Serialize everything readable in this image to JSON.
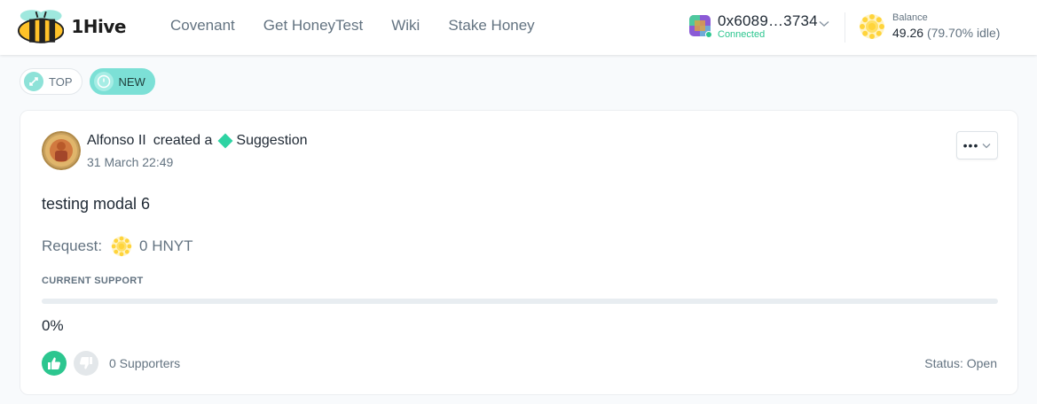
{
  "header": {
    "brand": "1Hive",
    "nav": [
      "Covenant",
      "Get HoneyTest",
      "Wiki",
      "Stake Honey"
    ],
    "account": {
      "address": "0x6089…3734",
      "status": "Connected"
    },
    "balance": {
      "label": "Balance",
      "value": "49.26",
      "idle": "(79.70% idle)"
    }
  },
  "filters": [
    {
      "label": "TOP",
      "icon": "rocket-icon",
      "active": false
    },
    {
      "label": "NEW",
      "icon": "clock-icon",
      "active": true
    }
  ],
  "proposal": {
    "author": "Alfonso II",
    "action": "created a",
    "type": "Suggestion",
    "date": "31 March 22:49",
    "title": "testing modal 6",
    "request_label": "Request:",
    "request_value": "0 HNYT",
    "support_label": "CURRENT SUPPORT",
    "support_fraction": 0,
    "support_percent": "0%",
    "supporters": "0 Supporters",
    "status": "Status: Open"
  },
  "colors": {
    "accent": "#2cc68f",
    "pill_active": "#7ce0d6",
    "suggestion": "#2ed3a3",
    "honey": "#ffd43b"
  }
}
